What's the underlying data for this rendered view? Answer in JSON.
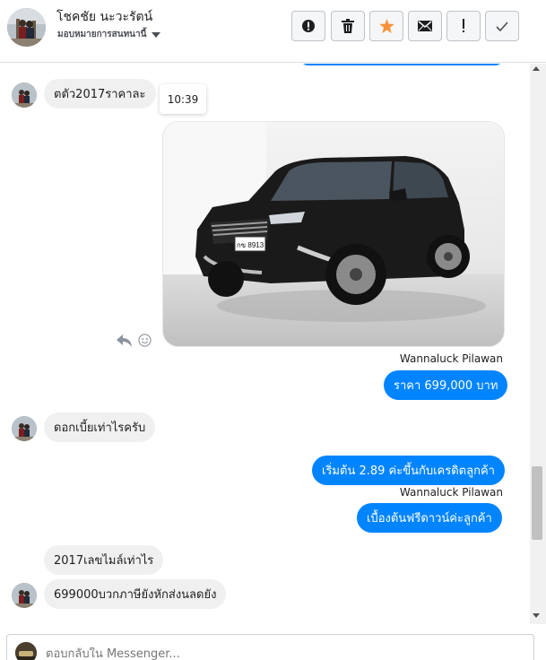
{
  "header": {
    "contact_name": "โชคชัย นะวะรัตน์",
    "assign_label": "มอบหมายการสนทนานี้",
    "buttons": [
      {
        "name": "spam-button",
        "icon": "alert-circle-icon"
      },
      {
        "name": "delete-button",
        "icon": "trash-icon"
      },
      {
        "name": "star-button",
        "icon": "star-icon",
        "color": "#f7923a"
      },
      {
        "name": "mail-button",
        "icon": "envelope-icon"
      },
      {
        "name": "important-button",
        "icon": "exclamation-icon"
      },
      {
        "name": "done-button",
        "icon": "check-icon"
      }
    ]
  },
  "messages": {
    "m1": "ตตัว2017ราคาละ",
    "time_tooltip": "10:39",
    "sender1": "Wannaluck Pilawan",
    "m2": "ราคา 699,000 บาท",
    "m3": "ดอกเบี้ยเท่าไรครับ",
    "m4": "เริ่มต้น 2.89 ค่ะขึ้นกับเครดิตลูกค้า",
    "sender2": "Wannaluck Pilawan",
    "m5": "เบื้องต้นฟรีดาวน์ค่ะลูกค้า",
    "m6": "2017เลขไมล์เท่าไร",
    "m7": "699000บวกภาษียังหักส่งนลดยัง",
    "photo_plate": "กข 8913"
  },
  "composer": {
    "placeholder": "ตอบกลับใน Messenger..."
  },
  "colors": {
    "outgoing": "#0084ff",
    "incoming": "#f1f0f0",
    "accent_star": "#f7923a"
  }
}
